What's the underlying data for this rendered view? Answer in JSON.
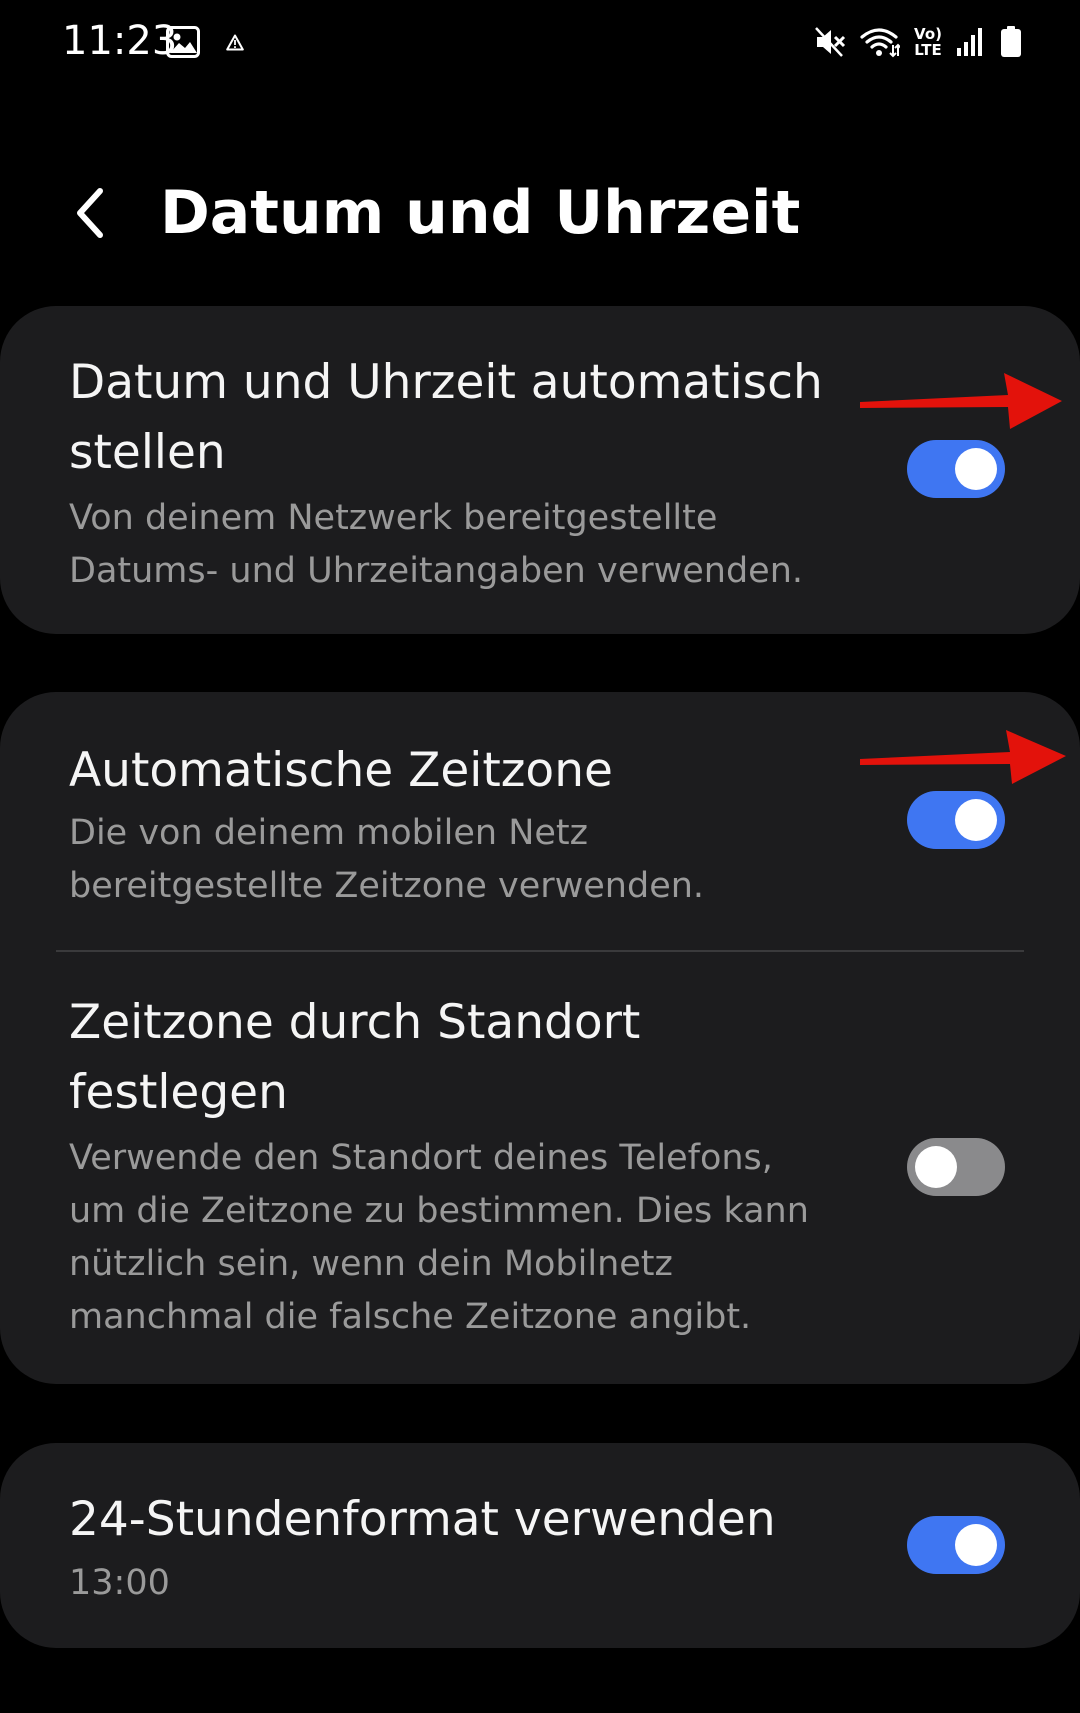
{
  "status_bar": {
    "time": "11:23",
    "left_icons": [
      "gallery-icon",
      "warning-icon"
    ],
    "right_icons": [
      "mute-icon",
      "wifi-icon",
      "volte-icon",
      "signal-icon",
      "battery-icon"
    ],
    "volte_top": "Vo)",
    "volte_bottom": "LTE"
  },
  "header": {
    "back_icon": "chevron-left-icon",
    "title": "Datum und Uhrzeit"
  },
  "settings": {
    "auto_datetime": {
      "title": "Datum und Uhrzeit automatisch stellen",
      "description": "Von deinem Netzwerk bereitgestellte Datums- und Uhrzeitangaben verwenden.",
      "enabled": true
    },
    "auto_timezone": {
      "title": "Automatische Zeitzone",
      "description": "Die von deinem mobilen Netz bereitgestellte Zeitzone verwenden.",
      "enabled": true
    },
    "timezone_location": {
      "title": "Zeitzone durch Standort festlegen",
      "description": "Verwende den Standort deines Telefons, um die Zeitzone zu bestimmen. Dies kann nützlich sein, wenn dein Mobilnetz manchmal die falsche Zeitzone angibt.",
      "enabled": false
    },
    "format_24h": {
      "title": "24-Stundenformat verwenden",
      "value": "13:00",
      "enabled": true
    }
  },
  "colors": {
    "background": "#000000",
    "card": "#1c1c1e",
    "switch_on": "#3f76f2",
    "switch_off": "#8a8a8c",
    "annotation_arrow": "#e3120b"
  }
}
